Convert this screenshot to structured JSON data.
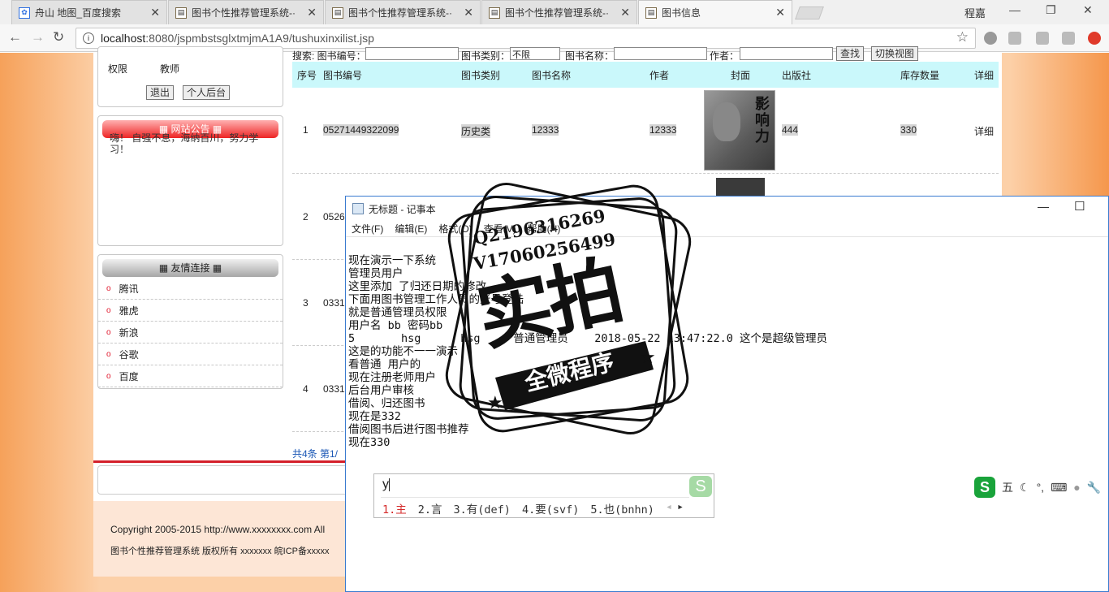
{
  "browser": {
    "tabs": [
      {
        "title": "舟山 地图_百度搜索",
        "icon": "paw-icon"
      },
      {
        "title": "图书个性推荐管理系统-·",
        "icon": "doc-icon"
      },
      {
        "title": "图书个性推荐管理系统-·",
        "icon": "doc-icon"
      },
      {
        "title": "图书个性推荐管理系统-·",
        "icon": "doc-icon"
      },
      {
        "title": "图书信息",
        "icon": "doc-icon"
      }
    ],
    "user": "程嘉",
    "url_host": "localhost",
    "url_path": ":8080/jspmbstsglxtmjmA1A9/tushuxinxilist.jsp"
  },
  "sidebar": {
    "perm_label": "权限",
    "perm_value": "教师",
    "logout": "退出",
    "backend": "个人后台",
    "notice_title": "网站公告",
    "notice_text": "嗨！  自强不息，海纳百川，努力学习！",
    "links_title": "友情连接",
    "links": [
      "腾讯",
      "雅虎",
      "新浪",
      "谷歌",
      "百度"
    ]
  },
  "search": {
    "prefix": "搜索: 图书编号：",
    "cat_label": "图书类别：",
    "cat_value": "不限",
    "name_label": "图书名称：",
    "author_label": "作者：",
    "find_btn": "查找",
    "view_btn": "切换视图"
  },
  "table": {
    "headers": [
      "序号",
      "图书编号",
      "图书类别",
      "图书名称",
      "作者",
      "封面",
      "出版社",
      "库存数量",
      "详细"
    ],
    "rows": [
      {
        "no": "1",
        "code": "05271449322099",
        "cat": "历史类",
        "name": "12333",
        "author": "12333",
        "publisher": "444",
        "stock": "330",
        "detail": "详细"
      },
      {
        "no": "2",
        "code": "0526"
      },
      {
        "no": "3",
        "code": "0331"
      },
      {
        "no": "4",
        "code": "0331"
      }
    ],
    "pager": "共4条  第1/"
  },
  "footer": {
    "copyright": "Copyright 2005-2015 http://www.xxxxxxxx.com All",
    "icp": "图书个性推荐管理系统 版权所有 xxxxxxx 皖ICP备xxxxx"
  },
  "notepad": {
    "title": "无标题 - 记事本",
    "menu": [
      "文件(F)",
      "编辑(E)",
      "格式(O)",
      "查看(V)",
      "帮助(H)"
    ],
    "lines": [
      "现在演示一下系统",
      "管理员用户",
      "这里添加 了归还日期的修改",
      "下面用图书管理工作人员的账号登陆",
      "就是普通管理员权限",
      "用户名 bb 密码bb",
      "",
      "5       hsg      hsg     普通管理员    2018-05-22 13:47:22.0 这个是超级管理员",
      "",
      "这是的功能不一一演示",
      "看普通 用户的",
      "",
      "现在注册老师用户",
      "后台用户审核",
      "借阅、归还图书",
      "现在是332",
      "借阅图书后进行图书推荐",
      "现在330"
    ]
  },
  "ime": {
    "input": "y",
    "candidates": [
      "1.主",
      "2.言",
      "3.有(def)",
      "4.要(svf)",
      "5.也(bnhn)"
    ],
    "mode": "五"
  },
  "watermark": {
    "line1": "Q2196316269",
    "line2": "V17060256499",
    "big": "实拍",
    "band": "全微程序"
  }
}
